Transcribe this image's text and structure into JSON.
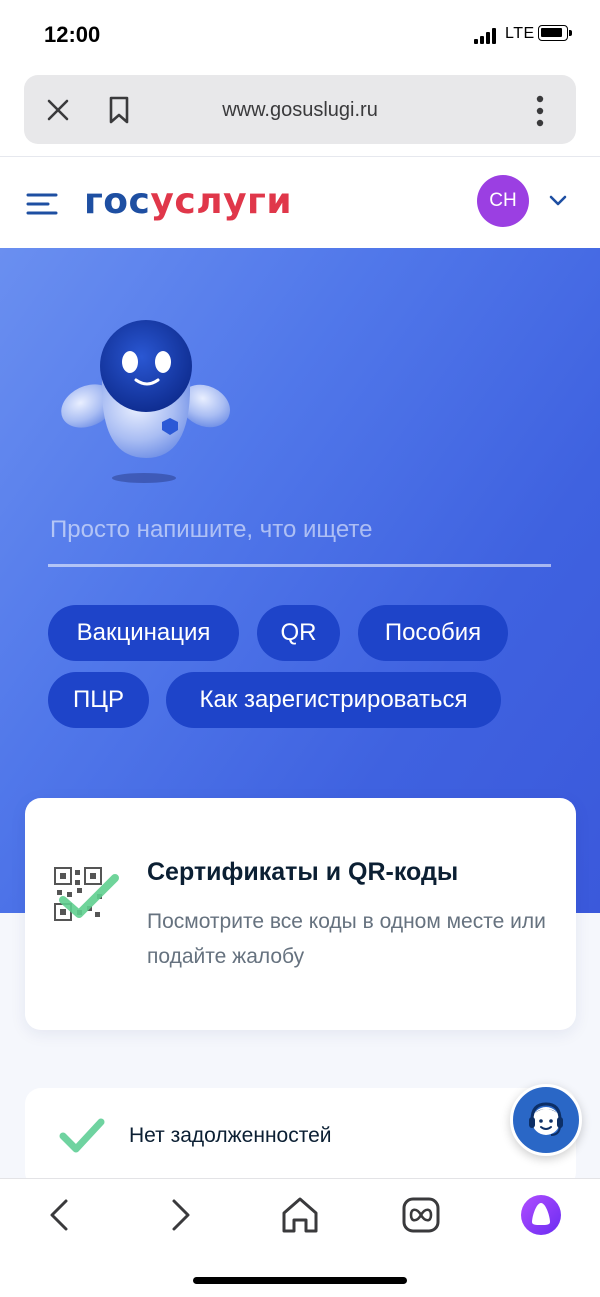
{
  "status_bar": {
    "time": "12:00",
    "network": "LTE"
  },
  "browser": {
    "url": "www.gosuslugi.ru",
    "icons": [
      "close-icon",
      "bookmark-icon",
      "more-vertical-icon"
    ]
  },
  "header": {
    "logo_part1": "гос",
    "logo_part2": "услуги",
    "avatar_initials": "СН",
    "colors": {
      "logo_blue": "#1e4fa2",
      "logo_red": "#e0374a",
      "avatar": "#9b3fe2"
    }
  },
  "hero": {
    "search_placeholder": "Просто напишите, что ищете",
    "chips": [
      "Вакцинация",
      "QR",
      "Пособия",
      "ПЦР",
      "Как зарегистрироваться"
    ],
    "colors": {
      "background": "#4a6de4",
      "chip": "#1e44c9"
    }
  },
  "certificates_card": {
    "title": "Сертификаты и QR-коды",
    "subtitle": "Посмотрите все коды в одном месте или подайте жалобу",
    "icon": "qr-check-icon"
  },
  "debt_card": {
    "text": "Нет задолженностей",
    "icon": "check-icon"
  },
  "support_button": {
    "icon": "support-agent-icon"
  },
  "bottom_nav": {
    "icons": [
      "back-icon",
      "forward-icon",
      "home-icon",
      "tabs-icon",
      "alice-icon"
    ]
  }
}
